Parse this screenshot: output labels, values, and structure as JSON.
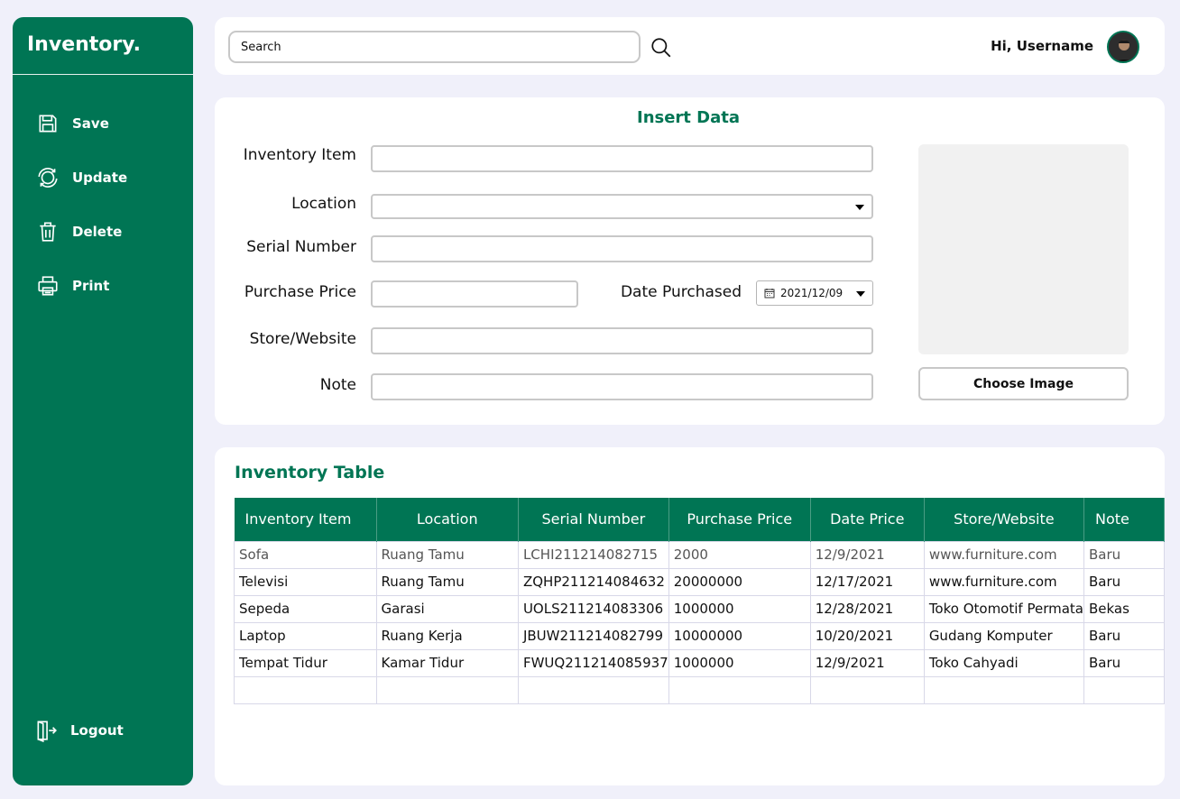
{
  "app": {
    "title": "Inventory."
  },
  "sidebar": {
    "items": [
      {
        "label": "Save",
        "icon": "save-icon"
      },
      {
        "label": "Update",
        "icon": "refresh-icon"
      },
      {
        "label": "Delete",
        "icon": "trash-icon"
      },
      {
        "label": "Print",
        "icon": "printer-icon"
      }
    ],
    "logout": {
      "label": "Logout",
      "icon": "logout-icon"
    }
  },
  "header": {
    "search_placeholder": "Search",
    "greeting": "Hi, Username"
  },
  "insert": {
    "title": "Insert Data",
    "labels": {
      "item": "Inventory Item",
      "location": "Location",
      "serial": "Serial Number",
      "price": "Purchase Price",
      "date": "Date Purchased",
      "store": "Store/Website",
      "note": "Note"
    },
    "date_value": "2021/12/09",
    "choose_image": "Choose Image"
  },
  "table": {
    "title": "Inventory Table",
    "columns": [
      "Inventory Item",
      "Location",
      "Serial Number",
      "Purchase Price",
      "Date Price",
      "Store/Website",
      "Note"
    ],
    "rows": [
      [
        "Sofa",
        "Ruang Tamu",
        "LCHI211214082715",
        "2000",
        "12/9/2021",
        "www.furniture.com",
        "Baru"
      ],
      [
        "Televisi",
        "Ruang Tamu",
        "ZQHP211214084632",
        "20000000",
        "12/17/2021",
        "www.furniture.com",
        "Baru"
      ],
      [
        "Sepeda",
        "Garasi",
        "UOLS211214083306",
        "1000000",
        "12/28/2021",
        "Toko Otomotif Permata",
        "Bekas"
      ],
      [
        "Laptop",
        "Ruang Kerja",
        "JBUW211214082799",
        "10000000",
        "10/20/2021",
        "Gudang Komputer",
        "Baru"
      ],
      [
        "Tempat Tidur",
        "Kamar Tidur",
        "FWUQ211214085937",
        "1000000",
        "12/9/2021",
        "Toko Cahyadi",
        "Baru"
      ]
    ]
  },
  "colors": {
    "accent": "#007554",
    "background": "#f0f0fa"
  }
}
